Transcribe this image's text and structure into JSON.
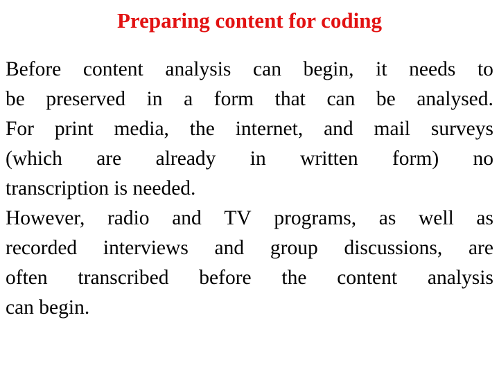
{
  "slide": {
    "title": "Preparing content for coding",
    "title_color": "#e21212",
    "body_color": "#000000",
    "background_color": "#ffffff",
    "paragraphs": [
      {
        "id": "paragraph-1",
        "text": "Before content analysis can begin, it needs to be preserved in a form that can be analysed. For print media, the internet, and mail surveys (which are already in written form) no transcription is needed.",
        "lines": [
          {
            "justified": true,
            "words": [
              "Before",
              "content",
              "analysis",
              "can",
              "begin,",
              "it",
              "needs",
              "to"
            ]
          },
          {
            "justified": true,
            "words": [
              "be",
              "preserved",
              "in",
              "a",
              "form",
              "that",
              "can",
              "be",
              "analysed."
            ]
          },
          {
            "justified": true,
            "words": [
              "For",
              "print",
              "media,",
              "the",
              "internet,",
              "and",
              "mail",
              "surveys"
            ]
          },
          {
            "justified": true,
            "words": [
              "(which",
              "are",
              "already",
              "in",
              "written",
              "form)",
              "no"
            ]
          },
          {
            "justified": false,
            "words": [
              "transcription is needed."
            ]
          }
        ]
      },
      {
        "id": "paragraph-2",
        "text": "However, radio and TV programs, as well as recorded interviews and group discussions, are often transcribed before the content analysis can begin.",
        "lines": [
          {
            "justified": true,
            "words": [
              "However,",
              "radio",
              "and",
              "TV",
              "programs,",
              "as",
              "well",
              "as"
            ]
          },
          {
            "justified": true,
            "words": [
              "recorded",
              "interviews",
              "and",
              "group",
              "discussions,",
              "are"
            ]
          },
          {
            "justified": true,
            "words": [
              "often",
              "transcribed",
              "before",
              "the",
              "content",
              "analysis"
            ]
          },
          {
            "justified": false,
            "words": [
              "can begin."
            ]
          }
        ]
      }
    ]
  }
}
